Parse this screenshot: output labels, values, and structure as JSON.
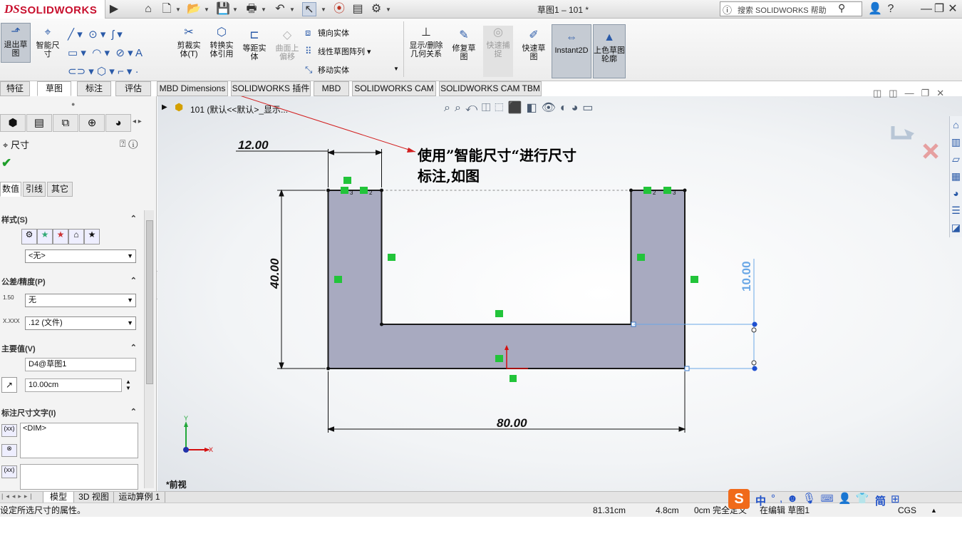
{
  "app": {
    "logo_ds": "DS",
    "logo_name": "SOLIDWORKS",
    "doc_title": "草图1 – 101 *",
    "search_placeholder": "搜索 SOLIDWORKS 帮助"
  },
  "commands": {
    "exit_sketch": "退出草图",
    "smart_dim": "智能尺寸",
    "trim": "剪裁实体(T)",
    "convert": "转换实体引用",
    "offset": "等距实体",
    "surface_offset": "曲面上偏移",
    "mirror": "镜向实体",
    "linear_pattern": "线性草图阵列",
    "move": "移动实体",
    "display_delete": "显示/删除几何关系",
    "repair": "修复草图",
    "quick_snap": "快速捕捉",
    "rapid_sketch": "快速草图",
    "instant2d": "Instant2D",
    "shaded_contours": "上色草图轮廓"
  },
  "tabs": [
    "特征",
    "草图",
    "标注",
    "评估",
    "MBD Dimensions",
    "SOLIDWORKS 插件",
    "MBD",
    "SOLIDWORKS CAM",
    "SOLIDWORKS CAM TBM"
  ],
  "active_tab": "草图",
  "panel": {
    "title": "尺寸",
    "subtabs": [
      "数值",
      "引线",
      "其它"
    ],
    "style_label": "样式(S)",
    "style_value": "<无>",
    "tolerance_label": "公差/精度(P)",
    "tolerance_value": "无",
    "precision_value": ".12 (文件)",
    "tol_icon_text": "1.50",
    "prec_icon_text": "X.XXX",
    "primary_label": "主要值(V)",
    "primary_name": "D4@草图1",
    "primary_value": "10.00cm",
    "dimtext_label": "标注尺寸文字(I)",
    "dimtext_value": "<DIM>"
  },
  "tree": {
    "root": "101  (默认<<默认>_显示..."
  },
  "drawing": {
    "dim_top": "12.00",
    "dim_left": "40.00",
    "dim_bottom": "80.00",
    "dim_right": "10.00",
    "view_label": "*前视",
    "callout_line1": "使用”智能尺寸“进行尺寸",
    "callout_line2": "标注,如图",
    "axis_y": "Y",
    "axis_x": "X",
    "rel_3": "3",
    "rel_2": "2"
  },
  "bottom_tabs": [
    "模型",
    "3D 视图",
    "运动算例 1"
  ],
  "status": {
    "message": "设定所选尺寸的属性。",
    "x": "81.31cm",
    "y": "4.8cm",
    "z": "0cm",
    "state": "完全定义",
    "editing": "在编辑 草图1",
    "units": "CGS"
  },
  "ime": {
    "lang": "中",
    "simplified": "简"
  },
  "colors": {
    "brand": "#c8102e",
    "sketch_fill": "#a8aac0",
    "relation_green": "#22c43a",
    "selected_dim": "#6aa7e6",
    "callout_arrow": "#d22020"
  }
}
